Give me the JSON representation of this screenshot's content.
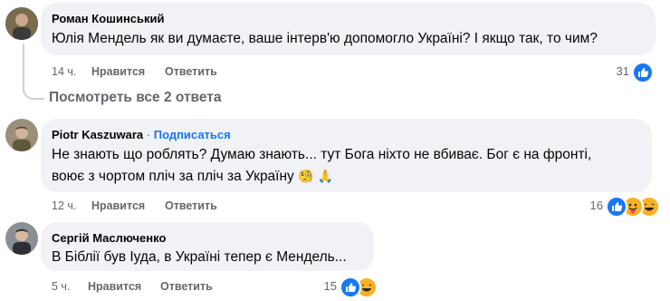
{
  "comments": [
    {
      "author": "Роман Кошинський",
      "text_lines": [
        "Юлія Мендель як ви думаєте, ваше інтерв'ю допомогло Україні? І якщо так, то чим?"
      ],
      "time": "14 ч.",
      "like_label": "Нравится",
      "reply_label": "Ответить",
      "reactions_count": "31",
      "reaction_icons": [
        "like-icon"
      ]
    },
    {
      "author": "Piotr Kaszuwara",
      "separator": " · ",
      "follow_label": "Подписаться",
      "text_lines": [
        "Не знають що роблять? Думаю знають... тут Бога ніхто не вбиває. Бог є на фронті,",
        "воює з чортом пліч за пліч за Україну"
      ],
      "text_emojis": [
        "🧐",
        "🙏"
      ],
      "time": "12 ч.",
      "like_label": "Нравится",
      "reply_label": "Ответить",
      "reactions_count": "16",
      "reaction_icons": [
        "like-icon",
        "care-icon",
        "haha-icon"
      ]
    },
    {
      "author": "Сергій Маслюченко",
      "text_lines": [
        "В Біблії був Іуда, в Україні тепер є Мендель..."
      ],
      "time": "5 ч.",
      "like_label": "Нравится",
      "reply_label": "Ответить",
      "reactions_count": "15",
      "reaction_icons": [
        "like-icon",
        "haha-icon"
      ]
    }
  ],
  "view_replies_label": "Посмотреть все 2 ответа",
  "colors": {
    "bubble": "#f0f2f5",
    "secondary_text": "#65676b",
    "like_blue": "#1877f2",
    "emoji_yellow": "#f7b125"
  }
}
